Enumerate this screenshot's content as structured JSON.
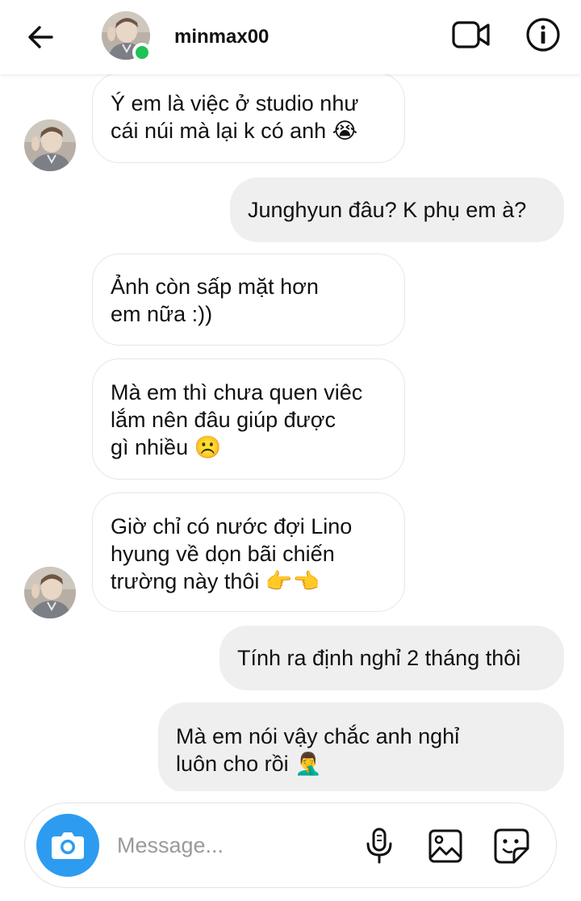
{
  "header": {
    "username": "minmax00",
    "online": true,
    "icons": {
      "back": "arrow-left-icon",
      "video": "video-camera-icon",
      "info": "info-icon"
    }
  },
  "messages": [
    {
      "direction": "incoming",
      "lines": [
        "Ý em là việc ở studio như",
        "cái núi mà lại k có anh 😭"
      ],
      "show_avatar": true
    },
    {
      "direction": "outgoing",
      "lines": [
        "Junghyun đâu? K phụ em à?"
      ]
    },
    {
      "direction": "incoming",
      "lines": [
        "Ảnh còn sấp mặt hơn",
        "em nữa :))"
      ]
    },
    {
      "direction": "incoming",
      "lines": [
        "Mà em thì chưa quen viêc",
        "lắm nên đâu giúp được",
        "gì nhiều ☹️"
      ]
    },
    {
      "direction": "incoming",
      "lines": [
        "Giờ chỉ có nước đợi Lino",
        "hyung về dọn bãi chiến",
        "trường này thôi 👉👈"
      ],
      "show_avatar": true
    },
    {
      "direction": "outgoing",
      "lines": [
        "Tính ra định nghỉ 2 tháng thôi"
      ]
    },
    {
      "direction": "outgoing",
      "lines": [
        "Mà em nói vậy chắc anh nghỉ",
        "luôn cho rồi 🤦‍♂️"
      ]
    }
  ],
  "composer": {
    "placeholder": "Message...",
    "value": "",
    "icons": {
      "camera": "camera-icon",
      "mic": "microphone-icon",
      "gallery": "image-icon",
      "sticker": "sticker-icon"
    }
  },
  "colors": {
    "online": "#1ec255",
    "camera_button": "#2d9cf0",
    "outgoing_bubble": "#efefef",
    "incoming_border": "#e6e6e6"
  }
}
